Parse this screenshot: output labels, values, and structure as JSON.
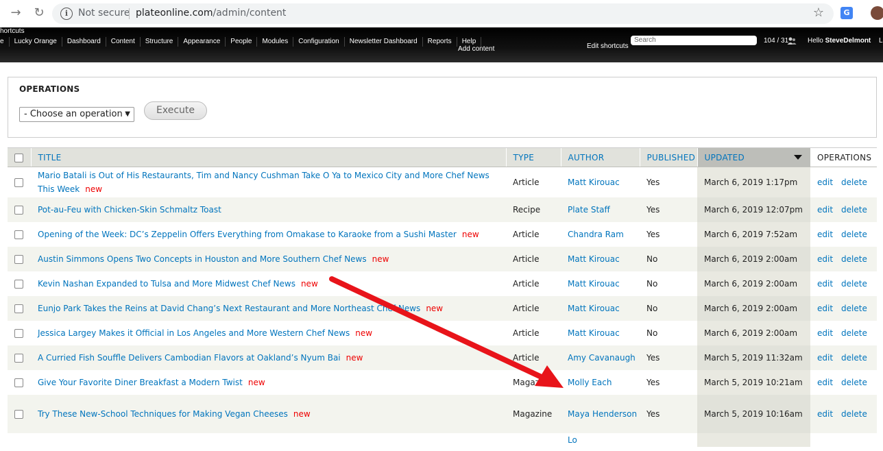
{
  "browser": {
    "not_secure": "Not secure",
    "url_host": "plateonline.com",
    "url_path": "/admin/content"
  },
  "toolbar": {
    "shortcuts": "hortcuts",
    "menu": [
      "e",
      "Lucky Orange",
      "Dashboard",
      "Content",
      "Structure",
      "Appearance",
      "People",
      "Modules",
      "Configuration",
      "Newsletter Dashboard",
      "Reports",
      "Help"
    ],
    "add_content": "Add content",
    "edit_shortcuts": "Edit shortcuts",
    "search_placeholder": "Search",
    "user_count": "104 / 31",
    "hello": "Hello",
    "username": "SteveDelmont",
    "logout": "Lo"
  },
  "operations": {
    "title": "OPERATIONS",
    "select_value": "- Choose an operation -",
    "execute_label": "Execute"
  },
  "table": {
    "headers": {
      "title": "TITLE",
      "type": "TYPE",
      "author": "AUTHOR",
      "published": "PUBLISHED",
      "updated": "UPDATED",
      "operations": "OPERATIONS"
    },
    "rows": [
      {
        "title": "Mario Batali is Out of His Restaurants, Tim and Nancy Cushman Take O Ya to Mexico City and More Chef News This Week",
        "new": "new",
        "type": "Article",
        "author": "Matt Kirouac",
        "published": "Yes",
        "updated": "March 6, 2019 1:17pm",
        "edit": "edit",
        "delete": "delete"
      },
      {
        "title": "Pot-au-Feu with Chicken-Skin Schmaltz Toast",
        "new": "",
        "type": "Recipe",
        "author": "Plate Staff",
        "published": "Yes",
        "updated": "March 6, 2019 12:07pm",
        "edit": "edit",
        "delete": "delete"
      },
      {
        "title": "Opening of the Week: DC’s Zeppelin Offers Everything from Omakase to Karaoke from a Sushi Master",
        "new": "new",
        "type": "Article",
        "author": "Chandra Ram",
        "published": "Yes",
        "updated": "March 6, 2019 7:52am",
        "edit": "edit",
        "delete": "delete"
      },
      {
        "title": "Austin Simmons Opens Two Concepts in Houston and More Southern Chef News",
        "new": "new",
        "type": "Article",
        "author": "Matt Kirouac",
        "published": "No",
        "updated": "March 6, 2019 2:00am",
        "edit": "edit",
        "delete": "delete"
      },
      {
        "title": "Kevin Nashan Expanded to Tulsa and More Midwest Chef News",
        "new": "new",
        "type": "Article",
        "author": "Matt Kirouac",
        "published": "No",
        "updated": "March 6, 2019 2:00am",
        "edit": "edit",
        "delete": "delete"
      },
      {
        "title": "Eunjo Park Takes the Reins at David Chang’s Next Restaurant and More Northeast Chef News",
        "new": "new",
        "type": "Article",
        "author": "Matt Kirouac",
        "published": "No",
        "updated": "March 6, 2019 2:00am",
        "edit": "edit",
        "delete": "delete"
      },
      {
        "title": "Jessica Largey Makes it Official in Los Angeles and More Western Chef News",
        "new": "new",
        "type": "Article",
        "author": "Matt Kirouac",
        "published": "No",
        "updated": "March 6, 2019 2:00am",
        "edit": "edit",
        "delete": "delete"
      },
      {
        "title": "A Curried Fish Souffle Delivers Cambodian Flavors at Oakland’s Nyum Bai",
        "new": "new",
        "type": "Article",
        "author": "Amy Cavanaugh",
        "published": "Yes",
        "updated": "March 5, 2019 11:32am",
        "edit": "edit",
        "delete": "delete"
      },
      {
        "title": "Give Your Favorite Diner Breakfast a Modern Twist",
        "new": "new",
        "type": "Magazine",
        "author": "Molly Each",
        "published": "Yes",
        "updated": "March 5, 2019 10:21am",
        "edit": "edit",
        "delete": "delete"
      },
      {
        "title": "Try These New-School Techniques for Making Vegan Cheeses",
        "new": "new",
        "type": "Magazine",
        "author": "Maya Henderson",
        "published": "Yes",
        "updated": "March 5, 2019 10:16am",
        "edit": "edit",
        "delete": "delete"
      },
      {
        "title": "",
        "new": "",
        "type": "",
        "author": "Lo",
        "published": "",
        "updated": "",
        "edit": "",
        "delete": ""
      }
    ]
  },
  "colors": {
    "link": "#0074bd",
    "new_marker": "#e00000",
    "annotation_arrow": "#e8141a"
  }
}
